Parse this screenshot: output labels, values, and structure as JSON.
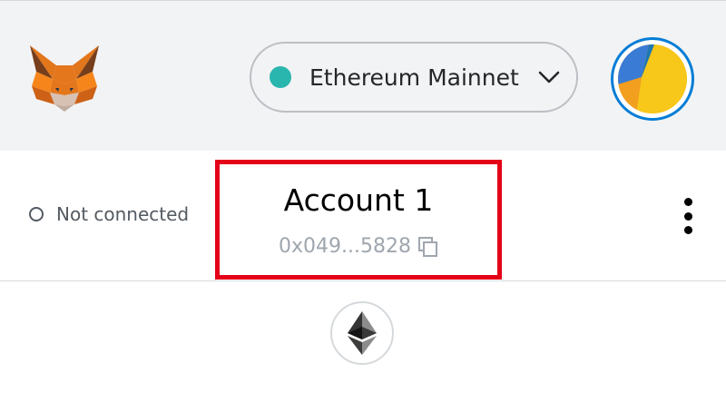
{
  "header": {
    "logo_icon": "metamask-fox-icon",
    "network": {
      "label": "Ethereum Mainnet",
      "status_color": "#29b6af",
      "dropdown_icon": "chevron-down-icon"
    },
    "avatar_icon": "jazzicon-avatar"
  },
  "account": {
    "connection_status": "Not connected",
    "name": "Account 1",
    "address": "0x049...5828",
    "copy_icon": "copy-icon",
    "menu_icon": "kebab-menu-icon",
    "highlight_color": "#e40018"
  },
  "token": {
    "icon": "ethereum-icon"
  }
}
